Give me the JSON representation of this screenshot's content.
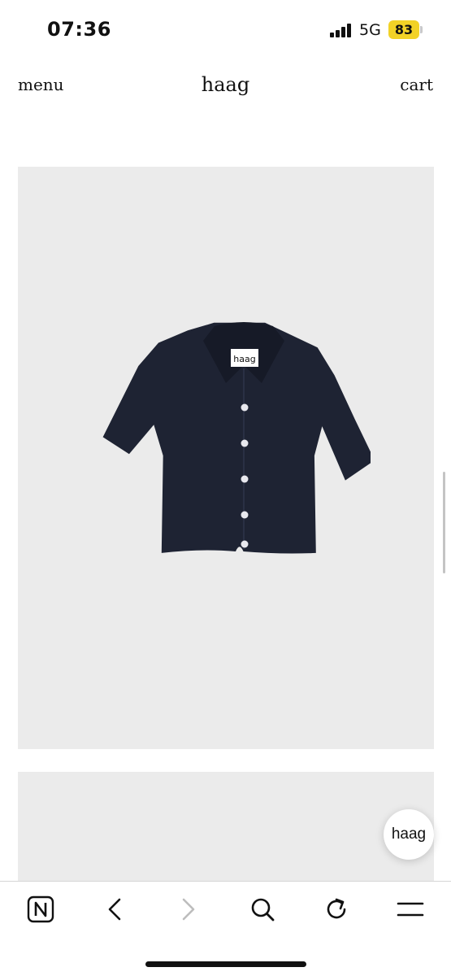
{
  "status": {
    "time": "07:36",
    "network": "5G",
    "battery": "83"
  },
  "header": {
    "menu_label": "menu",
    "logo": "haag",
    "cart_label": "cart"
  },
  "product": {
    "tag_label": "haag",
    "image_bg": "#ebebeb",
    "garment_color": "#1e2333"
  },
  "chat": {
    "label": "haag"
  },
  "toolbar": {
    "icons": [
      "browser-logo-icon",
      "back-icon",
      "forward-icon",
      "search-icon",
      "reload-icon",
      "menu-icon"
    ]
  }
}
